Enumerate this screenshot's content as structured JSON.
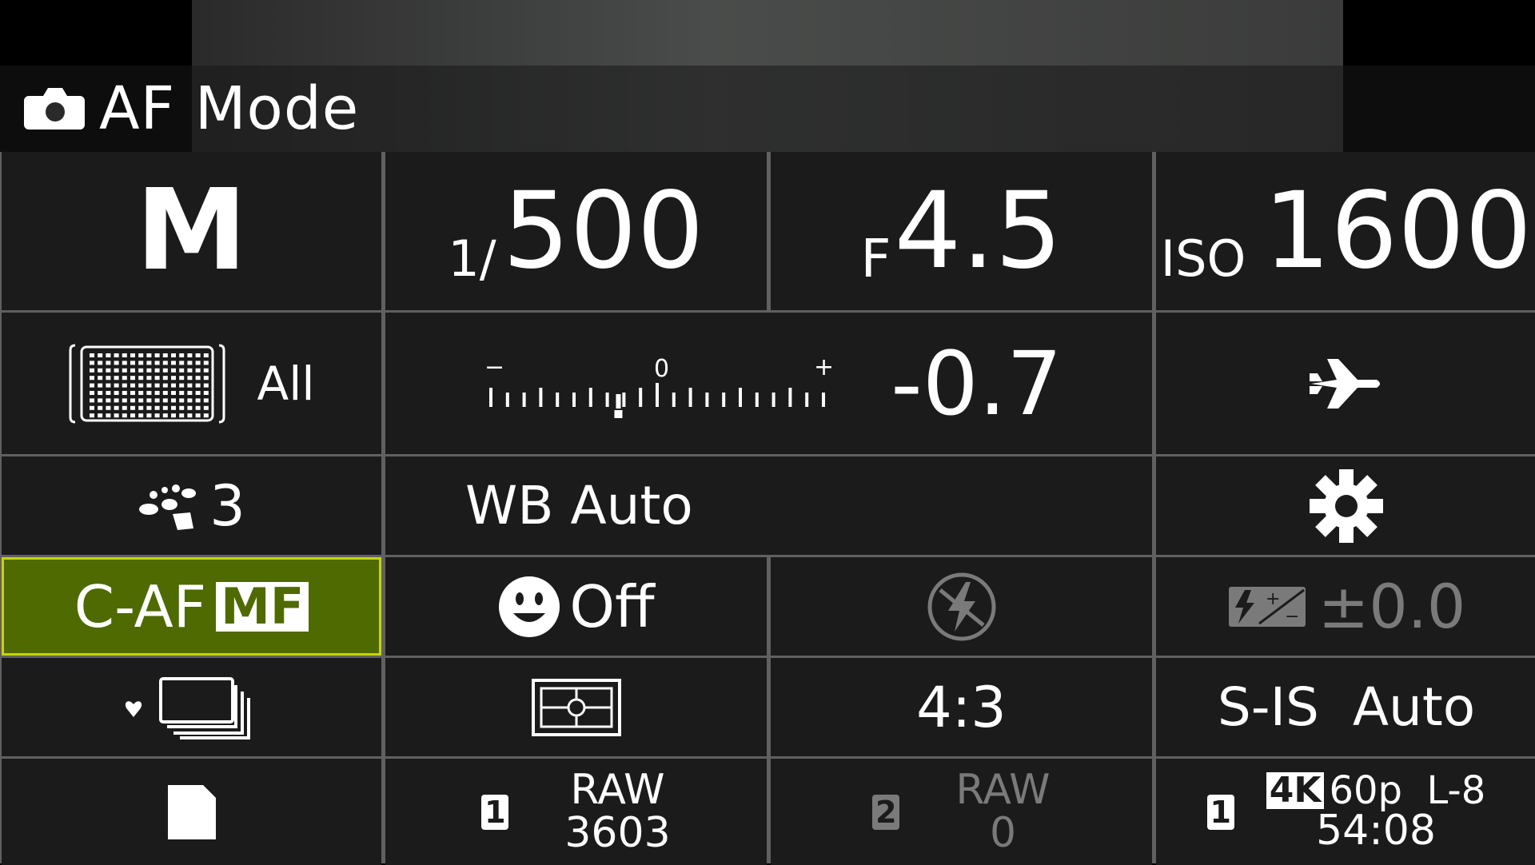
{
  "header": {
    "icon": "camera-icon",
    "title": "AF Mode"
  },
  "exposure": {
    "mode": "M",
    "shutter_prefix": "1/",
    "shutter_value": "500",
    "aperture_prefix": "F",
    "aperture_value": "4.5",
    "iso_prefix": "ISO",
    "iso_value": "1600"
  },
  "af_area": {
    "icon": "af-target-grid-icon",
    "label": "All"
  },
  "exposure_comp": {
    "scale_minus": "−",
    "scale_zero": "0",
    "scale_plus": "+",
    "value": "-0.7",
    "value_fraction": -0.7
  },
  "scene_icon": "airplane-icon",
  "picture_mode": {
    "icon": "art-filter-icon",
    "label": "3"
  },
  "white_balance": "WB Auto",
  "settings_icon": "gear-icon",
  "focus": {
    "mode": "C-AF",
    "badge": "MF"
  },
  "face_priority": {
    "icon": "face-detect-icon",
    "label": "Off"
  },
  "flash": {
    "icon": "flash-off-icon"
  },
  "flash_comp": {
    "icon": "flash-comp-icon",
    "value": "±0.0"
  },
  "drive": {
    "icon": "sequential-shooting-icon"
  },
  "metering": {
    "icon": "metering-icon"
  },
  "aspect": "4:3",
  "stabilizer": "S-IS  Auto",
  "storage": {
    "card_icon": "sd-card-icon",
    "slot1": {
      "num": "1",
      "format": "RAW",
      "count": "3603"
    },
    "slot2": {
      "num": "2",
      "format": "RAW",
      "count": "0"
    },
    "video": {
      "num": "1",
      "badge": "4K",
      "spec": "60p  L-8",
      "time": "54:08"
    }
  },
  "colors": {
    "selected_bg": "#4e6a00",
    "selected_border": "#c8d400",
    "cell_bg": "#1b1b1b"
  }
}
